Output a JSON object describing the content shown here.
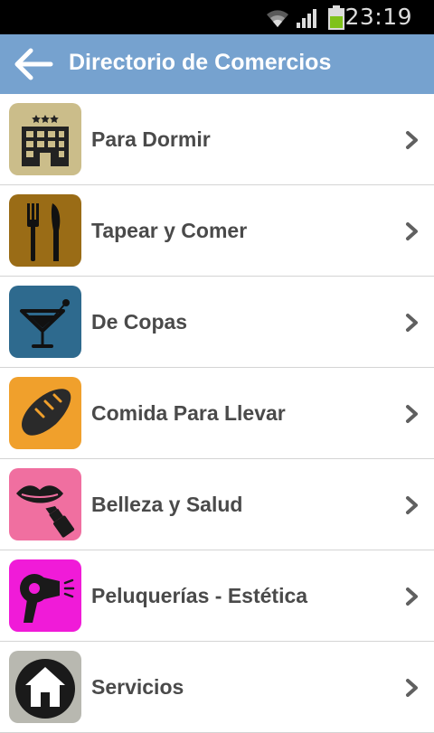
{
  "status_bar": {
    "time": "23:19",
    "icons": [
      "wifi-icon",
      "signal-icon",
      "battery-icon"
    ]
  },
  "header": {
    "title": "Directorio de Comercios",
    "back_icon": "arrow-left-icon"
  },
  "colors": {
    "header_bg": "#76a2cf",
    "text": "#4a4a4a",
    "divider": "#d4d4d4"
  },
  "categories": [
    {
      "label": "Para Dormir",
      "icon": "hotel-icon",
      "color": "#cbbd8a"
    },
    {
      "label": "Tapear y Comer",
      "icon": "fork-knife-icon",
      "color": "#9a6c16"
    },
    {
      "label": "De Copas",
      "icon": "cocktail-icon",
      "color": "#2e6a8e"
    },
    {
      "label": "Comida Para Llevar",
      "icon": "bread-icon",
      "color": "#f0a02c"
    },
    {
      "label": "Belleza y Salud",
      "icon": "lips-lipstick-icon",
      "color": "#f06fa0"
    },
    {
      "label": "Peluquerías - Estética",
      "icon": "hair-dryer-icon",
      "color": "#f01bd8"
    },
    {
      "label": "Servicios",
      "icon": "home-icon",
      "color": "#b8b8b0"
    }
  ]
}
